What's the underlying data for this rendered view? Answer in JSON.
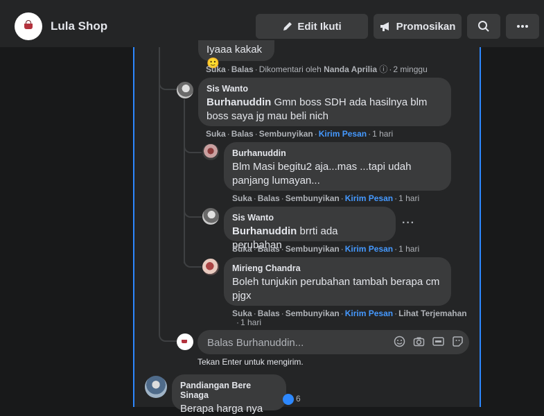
{
  "header": {
    "shop_name": "Lula Shop",
    "edit_label": "Edit Ikuti",
    "promo_label": "Promosikan",
    "search_icon": "search-icon",
    "more_icon": "more-icon"
  },
  "comments": {
    "top": {
      "text": "Iyaaa kakak",
      "emoji": "🙂",
      "meta": {
        "like": "Suka",
        "reply": "Balas",
        "commented_by": "Dikomentari oleh",
        "commenter": "Nanda Aprilia",
        "time": "2 minggu"
      }
    },
    "sis1": {
      "author": "Sis Wanto",
      "mention": "Burhanuddin",
      "text": "Gmn boss SDH ada hasilnya blm boss saya jg mau beli nich",
      "meta": {
        "like": "Suka",
        "reply": "Balas",
        "hide": "Sembunyikan",
        "send": "Kirim Pesan",
        "time": "1 hari"
      }
    },
    "burhan": {
      "author": "Burhanuddin",
      "text": "Blm Masi begitu2 aja...mas ...tapi udah panjang lumayan...",
      "meta": {
        "like": "Suka",
        "reply": "Balas",
        "hide": "Sembunyikan",
        "send": "Kirim Pesan",
        "time": "1 hari"
      }
    },
    "sis2": {
      "author": "Sis Wanto",
      "mention": "Burhanuddin",
      "text": "brrti ada perubahan",
      "more": "···",
      "meta": {
        "like": "Suka",
        "reply": "Balas",
        "hide": "Sembunyikan",
        "send": "Kirim Pesan",
        "time": "1 hari"
      }
    },
    "mirieng": {
      "author": "Mirieng Chandra",
      "text": "Boleh tunjukin perubahan tambah berapa cm pjgx",
      "meta": {
        "like": "Suka",
        "reply": "Balas",
        "hide": "Sembunyikan",
        "send": "Kirim Pesan",
        "translate": "Lihat Terjemahan",
        "time": "1 hari"
      }
    },
    "reply_box": {
      "placeholder": "Balas Burhanuddin...",
      "hint": "Tekan Enter untuk mengirim."
    },
    "pandi": {
      "author": "Pandiangan Bere Sinaga",
      "text": "Berapa harga nya",
      "reaction_count": "6"
    }
  },
  "colors": {
    "link": "#4599ff",
    "accent": "#2d88ff",
    "bubble": "#3a3b3c",
    "panel": "#242526"
  }
}
